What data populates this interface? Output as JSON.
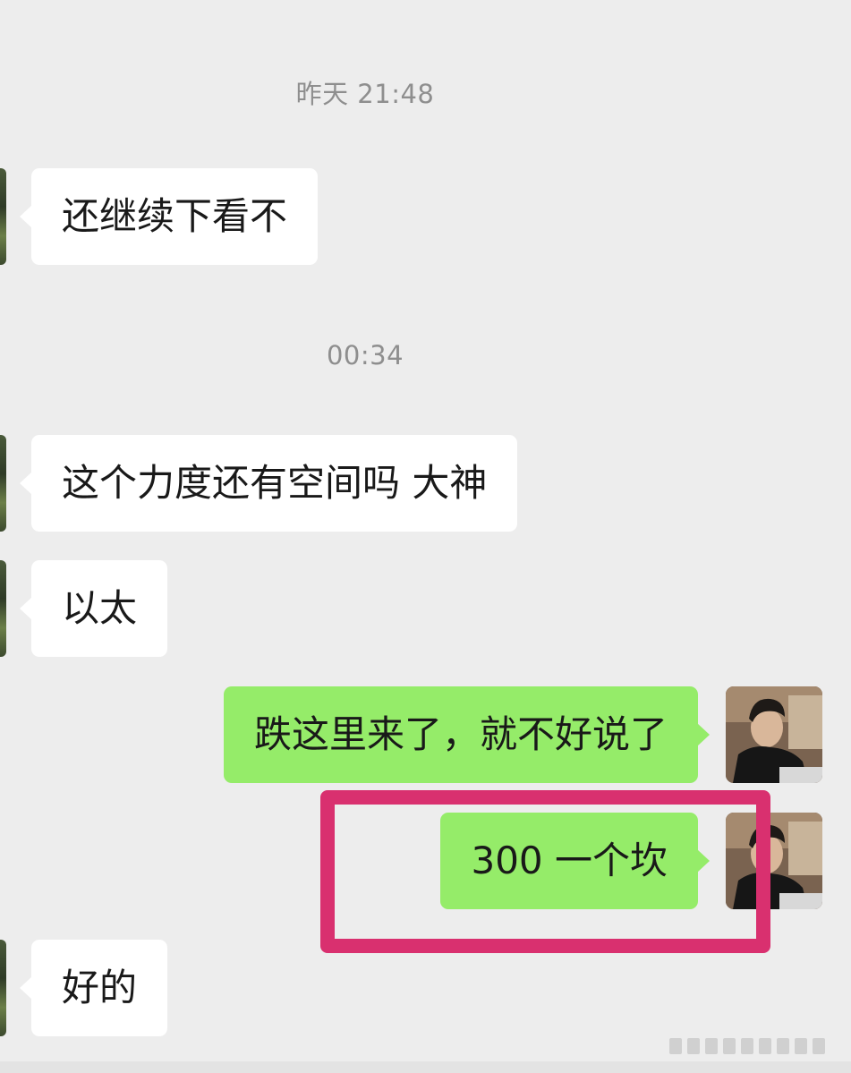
{
  "timestamps": {
    "first": "昨天 21:48",
    "second": "00:34"
  },
  "messages": [
    {
      "side": "in",
      "text": "还继续下看不"
    },
    {
      "side": "in",
      "text": "这个力度还有空间吗 大神"
    },
    {
      "side": "in",
      "text": "以太"
    },
    {
      "side": "out",
      "text": "跌这里来了，就不好说了"
    },
    {
      "side": "out",
      "text": "300 一个坎"
    },
    {
      "side": "in",
      "text": "好的"
    }
  ],
  "colors": {
    "background": "#ededed",
    "incoming_bubble": "#ffffff",
    "outgoing_bubble": "#95ec69",
    "highlight_box": "#d9306f",
    "timestamp_text": "#8e8e8e"
  }
}
